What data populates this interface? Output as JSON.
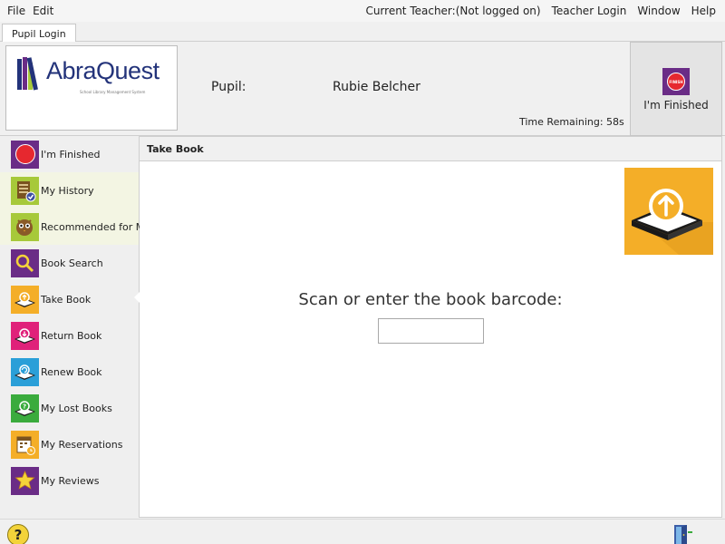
{
  "menu": {
    "file": "File",
    "edit": "Edit",
    "current_teacher": "Current Teacher:(Not logged on)",
    "teacher_login": "Teacher Login",
    "window": "Window",
    "help": "Help"
  },
  "tab": {
    "label": "Pupil Login"
  },
  "logo": {
    "name": "AbraQuest",
    "subtitle": "School Library Management System"
  },
  "header": {
    "pupil_label": "Pupil:",
    "pupil_name": "Rubie Belcher",
    "time_remaining": "Time Remaining: 58s",
    "finish_button": "I'm Finished",
    "finish_badge": "FINISH"
  },
  "sidebar": {
    "items": [
      {
        "label": "I'm Finished",
        "icon": "finish-icon",
        "color": "#6a2c86"
      },
      {
        "label": "My History",
        "icon": "history-icon",
        "color": "#a7c93a"
      },
      {
        "label": "Recommended for Me",
        "icon": "recommended-icon",
        "color": "#a7c93a"
      },
      {
        "label": "Book Search",
        "icon": "search-icon",
        "color": "#6a2c86"
      },
      {
        "label": "Take Book",
        "icon": "take-book-icon",
        "color": "#f4ae28"
      },
      {
        "label": "Return Book",
        "icon": "return-book-icon",
        "color": "#e0217a"
      },
      {
        "label": "Renew Book",
        "icon": "renew-book-icon",
        "color": "#2a9fd8"
      },
      {
        "label": "My Lost Books",
        "icon": "lost-books-icon",
        "color": "#3aab3d"
      },
      {
        "label": "My Reservations",
        "icon": "reservations-icon",
        "color": "#f4ae28"
      },
      {
        "label": "My Reviews",
        "icon": "reviews-icon",
        "color": "#6a2c86"
      }
    ]
  },
  "main": {
    "title": "Take Book",
    "prompt": "Scan or enter the book barcode:",
    "barcode_value": ""
  },
  "footer": {
    "help_symbol": "?"
  }
}
